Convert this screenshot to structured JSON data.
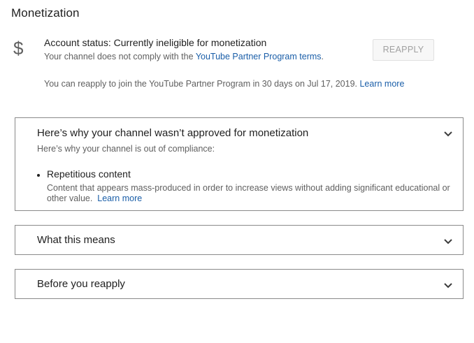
{
  "page": {
    "title": "Monetization"
  },
  "account_status": {
    "icon": "dollar-icon",
    "icon_glyph": "$",
    "title": "Account status: Currently ineligible for monetization",
    "subtitle_prefix": "Your channel does not comply with the ",
    "subtitle_link": "YouTube Partner Program terms",
    "subtitle_suffix": ".",
    "reapply_button": "REAPPLY",
    "reapply_note": "You can reapply to join the YouTube Partner Program in 30 days on Jul 17, 2019.",
    "learn_more": "Learn more"
  },
  "panels": [
    {
      "title": "Here’s why your channel wasn’t approved for monetization",
      "subtitle": "Here’s why your channel is out of compliance:",
      "items": [
        {
          "title": "Repetitious content",
          "description": "Content that appears mass-produced in order to increase views without adding significant educational or other value.",
          "learn_more": "Learn more"
        }
      ],
      "expanded": true
    },
    {
      "title": "What this means",
      "expanded": false
    },
    {
      "title": "Before you reapply",
      "expanded": false
    }
  ],
  "colors": {
    "link": "#1a5ea8",
    "secondary_text": "#606060",
    "panel_border": "#8a8a8a"
  }
}
